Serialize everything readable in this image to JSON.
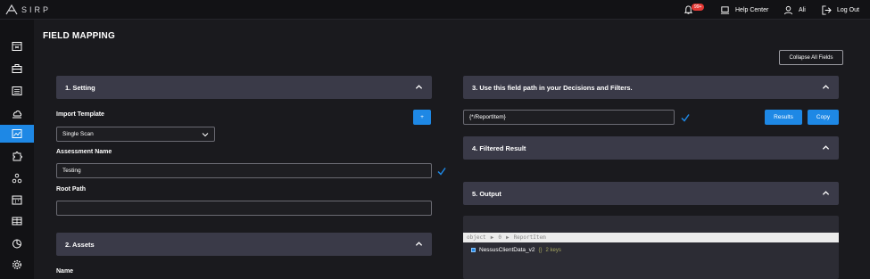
{
  "app": {
    "logo_text": "SIRP"
  },
  "topbar": {
    "notification_count": "99+",
    "help_center_label": "Help Center",
    "user_name": "Ali",
    "logout_label": "Log Out"
  },
  "sidebar": {
    "items": [
      {
        "icon": "dashboard-icon"
      },
      {
        "icon": "briefcase-icon"
      },
      {
        "icon": "list-icon"
      },
      {
        "icon": "cloud-icon"
      },
      {
        "icon": "chart-icon",
        "active": true
      },
      {
        "icon": "puzzle-icon"
      },
      {
        "icon": "network-icon"
      },
      {
        "icon": "calendar-icon"
      },
      {
        "icon": "database-icon"
      },
      {
        "icon": "pie-chart-icon"
      },
      {
        "icon": "settings-icon"
      }
    ]
  },
  "page": {
    "title": "FIELD MAPPING",
    "collapse_all_label": "Collapse All Fields"
  },
  "setting": {
    "header": "1. Setting",
    "import_template_label": "Import Template",
    "import_template_value": "Single Scan",
    "add_button_label": "+",
    "assessment_name_label": "Assessment Name",
    "assessment_name_value": "Testing",
    "root_path_label": "Root Path",
    "root_path_value": ""
  },
  "assets": {
    "header": "2. Assets",
    "name_label": "Name"
  },
  "field_path": {
    "header": "3. Use this field path in your Decisions and Filters.",
    "path_value": "{*/ReportItem}",
    "results_label": "Results",
    "copy_label": "Copy"
  },
  "filtered": {
    "header": "4. Filtered Result"
  },
  "output": {
    "header": "5. Output",
    "path_root": "object",
    "path_index": "0",
    "path_leaf": "ReportItem",
    "node_name": "NessusClientData_v2",
    "node_braces": "{}",
    "node_keys": "2 keys"
  },
  "colors": {
    "accent": "#1e88e5",
    "panel": "#3a3a48",
    "background": "#1a1a1e"
  }
}
